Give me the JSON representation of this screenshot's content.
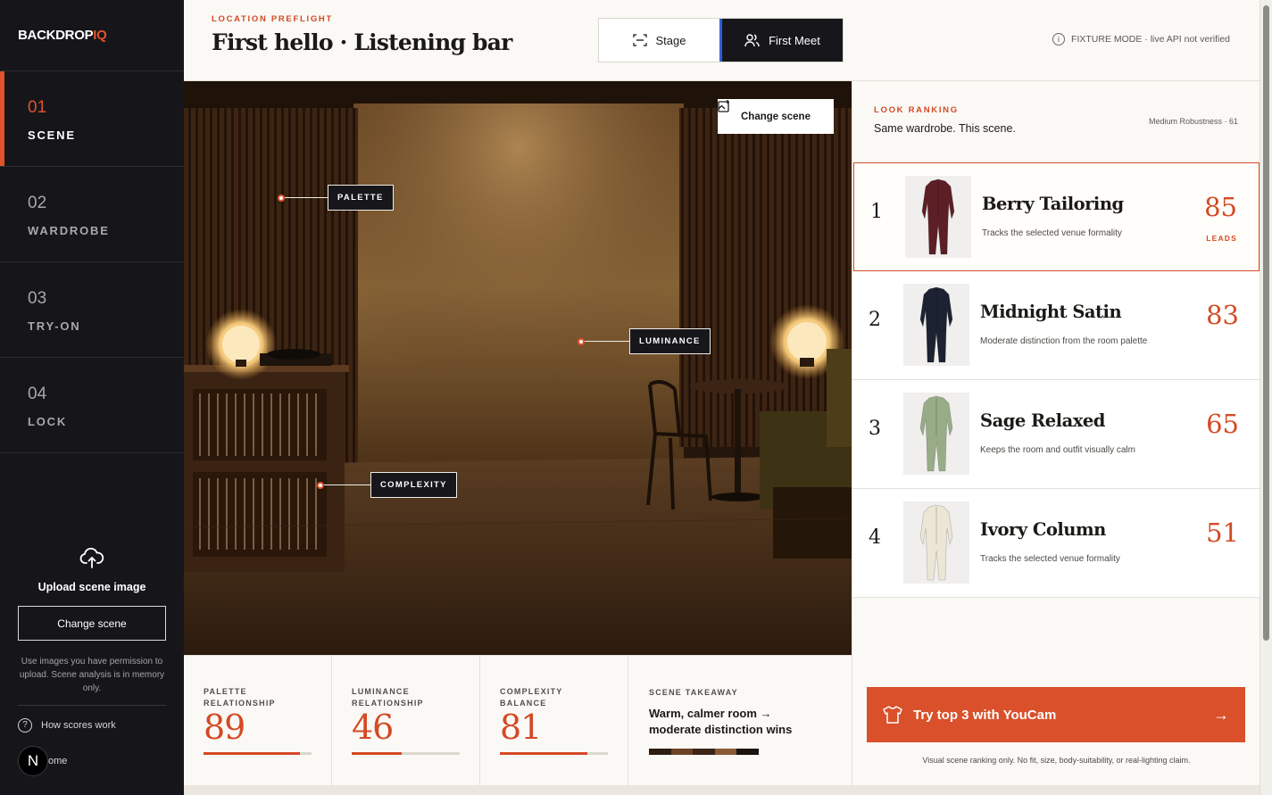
{
  "brand": {
    "name_a": "BACKDROP",
    "name_b": "IQ"
  },
  "steps": [
    {
      "num": "01",
      "label": "SCENE"
    },
    {
      "num": "02",
      "label": "WARDROBE"
    },
    {
      "num": "03",
      "label": "TRY-ON"
    },
    {
      "num": "04",
      "label": "LOCK"
    }
  ],
  "upload": {
    "title": "Upload scene image",
    "button": "Change scene",
    "note": "Use images you have permission to upload. Scene analysis is in memory only."
  },
  "sidebar_footer": {
    "how": "How scores work",
    "avatar": "N",
    "home": "ome"
  },
  "header": {
    "eyebrow": "LOCATION PREFLIGHT",
    "title": "First hello · Listening bar",
    "mode_stage": "Stage",
    "mode_meet": "First Meet",
    "fixture": "FIXTURE MODE · live API not verified"
  },
  "scene": {
    "change_button": "Change scene",
    "tags": {
      "palette": "PALETTE",
      "luminance": "LUMINANCE",
      "complexity": "COMPLEXITY"
    }
  },
  "metrics": [
    {
      "label": "PALETTE RELATIONSHIP",
      "value": "89",
      "fill": 0.89
    },
    {
      "label": "LUMINANCE RELATIONSHIP",
      "value": "46",
      "fill": 0.46
    },
    {
      "label": "COMPLEXITY BALANCE",
      "value": "81",
      "fill": 0.81
    }
  ],
  "takeaway": {
    "label": "SCENE TAKEAWAY",
    "text": "Warm, calmer room → moderate distinction wins",
    "swatches": [
      "#2c1c12",
      "#6b4428",
      "#3a2516",
      "#8a5a34",
      "#1a1410",
      "#f2efe9",
      "#b07a4a"
    ]
  },
  "ranking": {
    "eyebrow": "LOOK RANKING",
    "subtitle": "Same wardrobe. This scene.",
    "robustness": "Medium Robustness · 61",
    "items": [
      {
        "rank": "1",
        "name": "Berry Tailoring",
        "desc": "Tracks the selected venue formality",
        "score": "85",
        "badge": "LEADS",
        "color": "#5c1f26"
      },
      {
        "rank": "2",
        "name": "Midnight Satin",
        "desc": "Moderate distinction from the room palette",
        "score": "83",
        "color": "#1c2232"
      },
      {
        "rank": "3",
        "name": "Sage Relaxed",
        "desc": "Keeps the room and outfit visually calm",
        "score": "65",
        "color": "#98ac88"
      },
      {
        "rank": "4",
        "name": "Ivory Column",
        "desc": "Tracks the selected venue formality",
        "score": "51",
        "color": "#ece6d6"
      }
    ],
    "cta": "Try top 3 with YouCam",
    "disclaimer": "Visual scene ranking only. No fit, size, body-suitability, or real-lighting claim."
  },
  "colors": {
    "accent": "#d44a24",
    "sidebar": "#16161a",
    "stage_indicator": "#2f62d9"
  }
}
